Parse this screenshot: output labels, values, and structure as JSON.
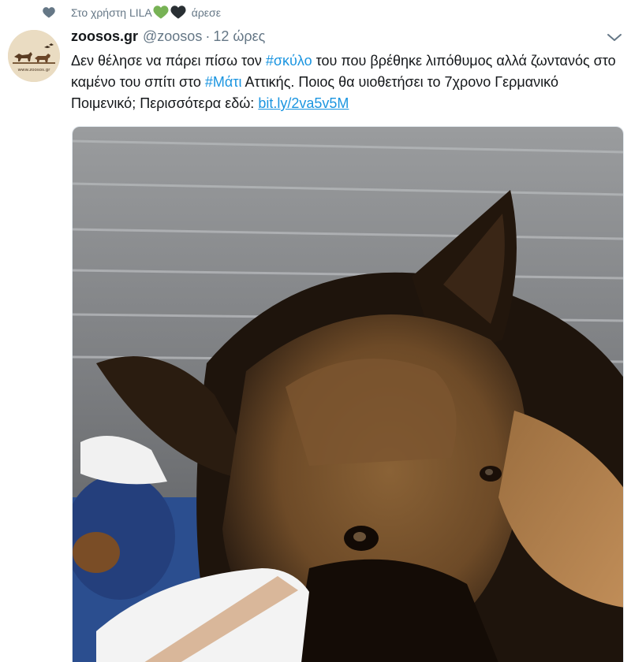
{
  "social_context": {
    "prefix": "Στο χρήστη LILA",
    "hearts": [
      "💚",
      "🖤"
    ],
    "suffix": "άρεσε",
    "heart_color": "#657786"
  },
  "tweet": {
    "display_name": "zoosos.gr",
    "handle": "@zoosos",
    "separator": "·",
    "time": "12 ώρες",
    "avatar_label": "www.zoosos.gr",
    "text": {
      "part1": "Δεν θέλησε να πάρει πίσω τον ",
      "hashtag1": "#σκύλο",
      "part2": " του που βρέθηκε λιπόθυμος αλλά ζωντανός στο καμένο του σπίτι στο ",
      "hashtag2": "#Μάτι",
      "part3": " Αττικής. Ποιος θα υιοθετήσει το 7χρονο Γερμανικό Ποιμενικό; Περισσότερα εδώ: ",
      "link": "bit.ly/2va5v5M"
    },
    "media_alt": "German shepherd lying at a veterinary clinic with a bandaged paw",
    "link_color": "#1b95e0"
  }
}
